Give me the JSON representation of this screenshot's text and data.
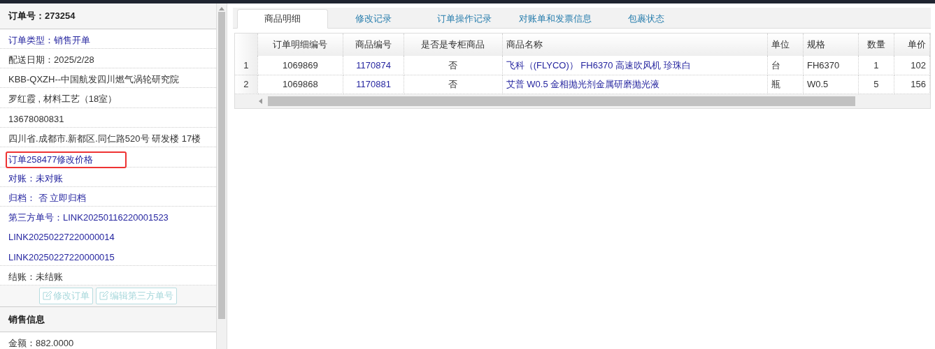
{
  "order_panel": {
    "title": "订单号：273254",
    "items": [
      {
        "text": "订单类型：销售开单",
        "link": true,
        "highlighted": false,
        "divider": true
      },
      {
        "text": "配送日期：2025/2/28",
        "link": false,
        "highlighted": false,
        "divider": true
      },
      {
        "text": "KBB-QXZH--中国航发四川燃气涡轮研究院",
        "link": false,
        "highlighted": false,
        "divider": true
      },
      {
        "text": "罗红霞 , 材料工艺（18室）",
        "link": false,
        "highlighted": false,
        "divider": true
      },
      {
        "text": "13678080831",
        "link": false,
        "highlighted": false,
        "divider": true
      },
      {
        "text": "四川省.成都市.新都区.同仁路520号 研发楼 17楼",
        "link": false,
        "highlighted": false,
        "divider": true
      },
      {
        "text": "订单258477修改价格",
        "link": true,
        "highlighted": true,
        "divider": true
      },
      {
        "text": "对账：未对账",
        "link": true,
        "highlighted": false,
        "divider": true
      },
      {
        "text": "归档： 否 立即归档",
        "link": true,
        "highlighted": false,
        "divider": true
      },
      {
        "text": "第三方单号：LINK20250116220001523",
        "link": true,
        "highlighted": false,
        "divider": false
      },
      {
        "text": "LINK20250227220000014",
        "link": true,
        "highlighted": false,
        "divider": false
      },
      {
        "text": "LINK20250227220000015",
        "link": true,
        "highlighted": false,
        "divider": true
      },
      {
        "text": "结账：未结账",
        "link": false,
        "highlighted": false,
        "divider": true
      }
    ],
    "buttons": [
      {
        "label": "修改订单",
        "disabled": true
      },
      {
        "label": "编辑第三方单号",
        "disabled": true
      }
    ]
  },
  "sales_panel": {
    "title": "销售信息",
    "items": [
      "金额：882.0000"
    ]
  },
  "tabs": [
    {
      "label": "商品明细",
      "selected": true
    },
    {
      "label": "修改记录",
      "selected": false
    },
    {
      "label": "订单操作记录",
      "selected": false
    },
    {
      "label": "对账单和发票信息",
      "selected": false
    },
    {
      "label": "包裹状态",
      "selected": false
    }
  ],
  "table": {
    "columns": [
      {
        "label": "订单明细编号",
        "link": false
      },
      {
        "label": "商品编号",
        "link": true
      },
      {
        "label": "是否是专柜商品",
        "link": false
      },
      {
        "label": "商品名称",
        "link": true
      },
      {
        "label": "单位",
        "link": false
      },
      {
        "label": "规格",
        "link": false
      },
      {
        "label": "数量",
        "link": false
      },
      {
        "label": "单价",
        "link": false
      }
    ],
    "rows": [
      {
        "number": "1",
        "cells": [
          "1069869",
          "1170874",
          "否",
          "飞科（(FLYCO)） FH6370 高速吹风机 珍珠白",
          "台",
          "FH6370",
          "1",
          "102"
        ]
      },
      {
        "number": "2",
        "cells": [
          "1069868",
          "1170881",
          "否",
          "艾普 W0.5 金相抛光剂金属研磨抛光液",
          "瓶",
          "W0.5",
          "5",
          "156"
        ]
      }
    ]
  }
}
